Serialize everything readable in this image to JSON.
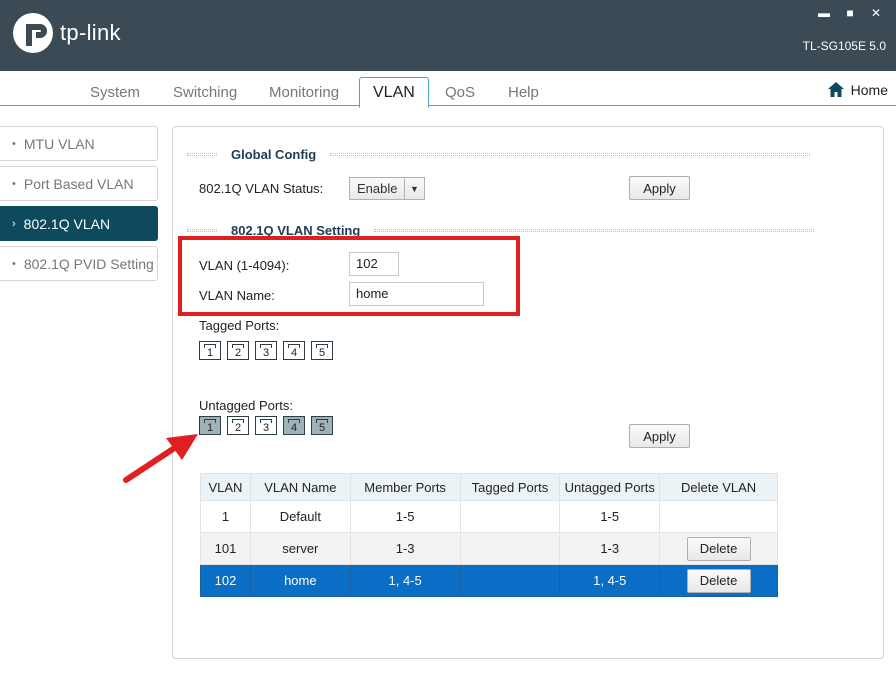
{
  "brand": {
    "name": "tp-link",
    "model": "TL-SG105E 5.0"
  },
  "window_controls": {
    "minimize": "▬",
    "maximize": "■",
    "close": "✕"
  },
  "nav": {
    "tabs": [
      "System",
      "Switching",
      "Monitoring",
      "VLAN",
      "QoS",
      "Help"
    ],
    "active": "VLAN",
    "home_label": "Home"
  },
  "sidebar": {
    "items": [
      {
        "label": "MTU VLAN",
        "bullet": "•"
      },
      {
        "label": "Port Based VLAN",
        "bullet": "•"
      },
      {
        "label": "802.1Q VLAN",
        "bullet": "›"
      },
      {
        "label": "802.1Q PVID Setting",
        "bullet": "•"
      }
    ],
    "active": "802.1Q VLAN"
  },
  "global_config": {
    "title": "Global Config",
    "status_label": "802.1Q VLAN Status:",
    "status_value": "Enable",
    "apply_label": "Apply"
  },
  "vlan_setting": {
    "title": "802.1Q VLAN Setting",
    "vlan_id_label": "VLAN (1-4094):",
    "vlan_id_value": "102",
    "vlan_name_label": "VLAN Name:",
    "vlan_name_value": "home",
    "tagged_label": "Tagged Ports:",
    "untagged_label": "Untagged Ports:",
    "ports": [
      "1",
      "2",
      "3",
      "4",
      "5"
    ],
    "tagged_selected": [],
    "untagged_selected": [
      "1",
      "4",
      "5"
    ],
    "apply_label": "Apply"
  },
  "table": {
    "headers": [
      "VLAN",
      "VLAN Name",
      "Member Ports",
      "Tagged Ports",
      "Untagged Ports",
      "Delete VLAN"
    ],
    "rows": [
      {
        "vlan": "1",
        "name": "Default",
        "member": "1-5",
        "tagged": "",
        "untagged": "1-5",
        "delete": ""
      },
      {
        "vlan": "101",
        "name": "server",
        "member": "1-3",
        "tagged": "",
        "untagged": "1-3",
        "delete": "Delete"
      },
      {
        "vlan": "102",
        "name": "home",
        "member": "1, 4-5",
        "tagged": "",
        "untagged": "1, 4-5",
        "delete": "Delete"
      }
    ],
    "selected_row": 2
  },
  "colors": {
    "header_bg": "#3c4a55",
    "sidebar_active": "#0d4a5e",
    "selected_row": "#0a6ec4",
    "highlight": "#e02020"
  }
}
